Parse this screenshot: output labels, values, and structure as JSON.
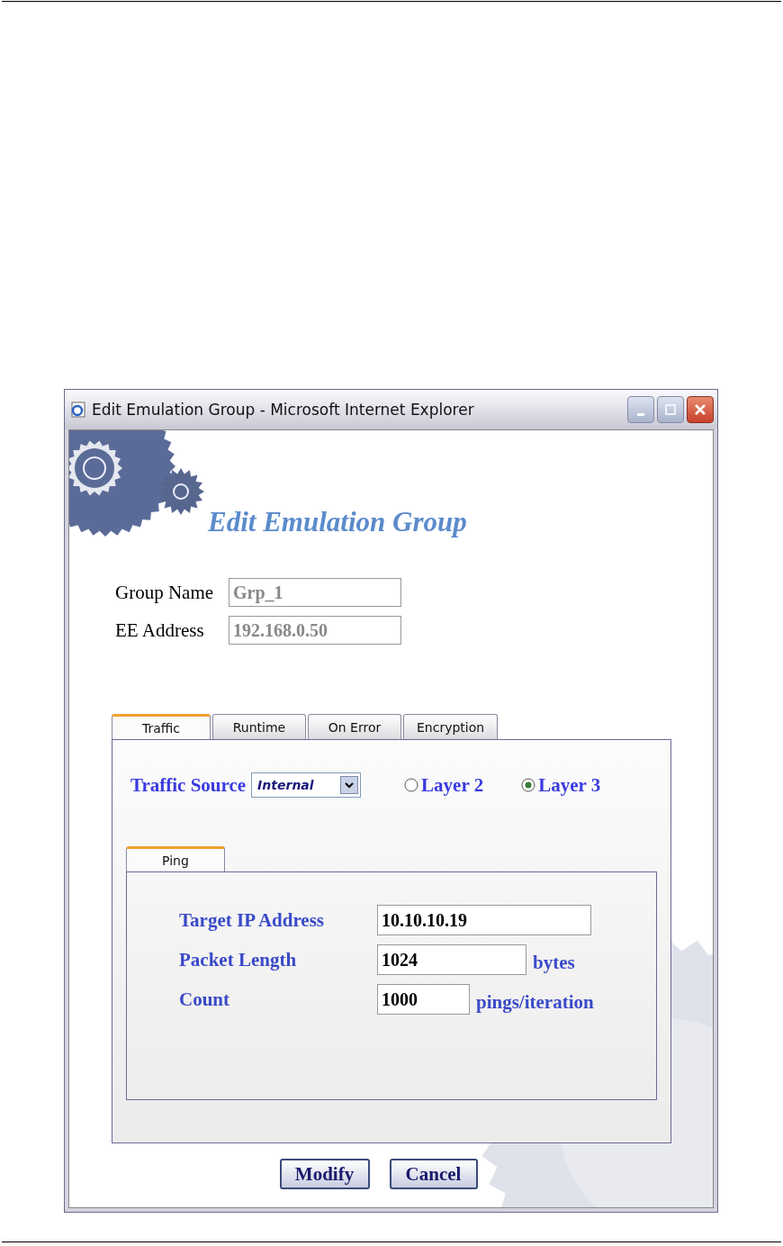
{
  "window": {
    "title": "Edit Emulation Group - Microsoft Internet Explorer"
  },
  "heading": "Edit Emulation Group",
  "fields": [
    {
      "label": "Group Name",
      "value": "Grp_1",
      "disabled": true
    },
    {
      "label": "EE Address",
      "value": "192.168.0.50",
      "disabled": true
    }
  ],
  "tabs": [
    {
      "label": "Traffic",
      "selected": true
    },
    {
      "label": "Runtime",
      "selected": false
    },
    {
      "label": "On Error",
      "selected": false
    },
    {
      "label": "Encryption",
      "selected": false
    }
  ],
  "traffic_source": {
    "label": "Traffic Source",
    "value": "Internal"
  },
  "layers": [
    {
      "label": "Layer 2",
      "selected": false
    },
    {
      "label": "Layer 3",
      "selected": true
    }
  ],
  "subtabs": [
    {
      "label": "Ping",
      "selected": true
    }
  ],
  "ping_fields": [
    {
      "label": "Target IP Address",
      "value": "10.10.10.19"
    },
    {
      "label": "Packet Length",
      "value": "1024",
      "unit": "bytes"
    },
    {
      "label": "Count",
      "value": "1000",
      "unit": "pings/iteration"
    }
  ],
  "buttons": [
    "Modify",
    "Cancel"
  ]
}
